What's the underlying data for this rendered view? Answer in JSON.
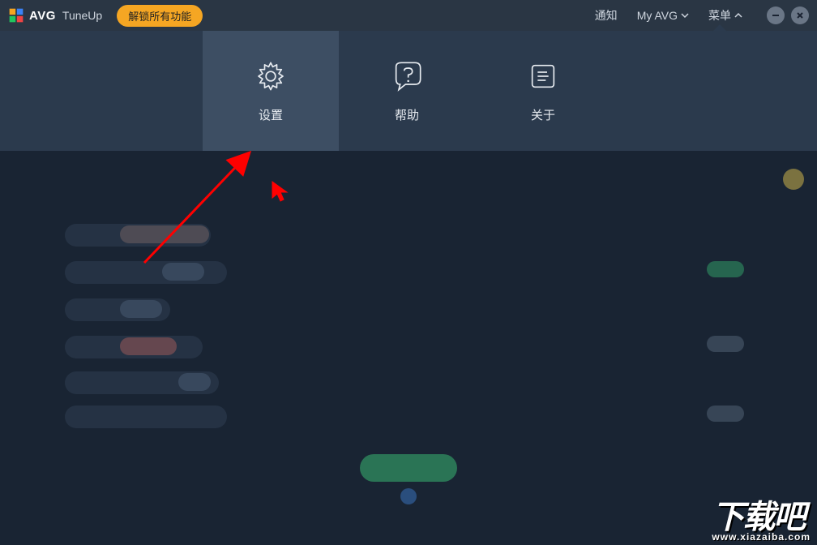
{
  "titlebar": {
    "brand": "AVG",
    "product": "TuneUp",
    "unlock_label": "解锁所有功能",
    "nav": {
      "notifications": "通知",
      "my_avg": "My AVG",
      "menu": "菜单"
    }
  },
  "menu": {
    "tiles": [
      {
        "label": "设置",
        "icon": "gear"
      },
      {
        "label": "帮助",
        "icon": "help"
      },
      {
        "label": "关于",
        "icon": "about"
      }
    ]
  },
  "watermark": {
    "big": "下载吧",
    "url": "www.xiazaiba.com"
  }
}
